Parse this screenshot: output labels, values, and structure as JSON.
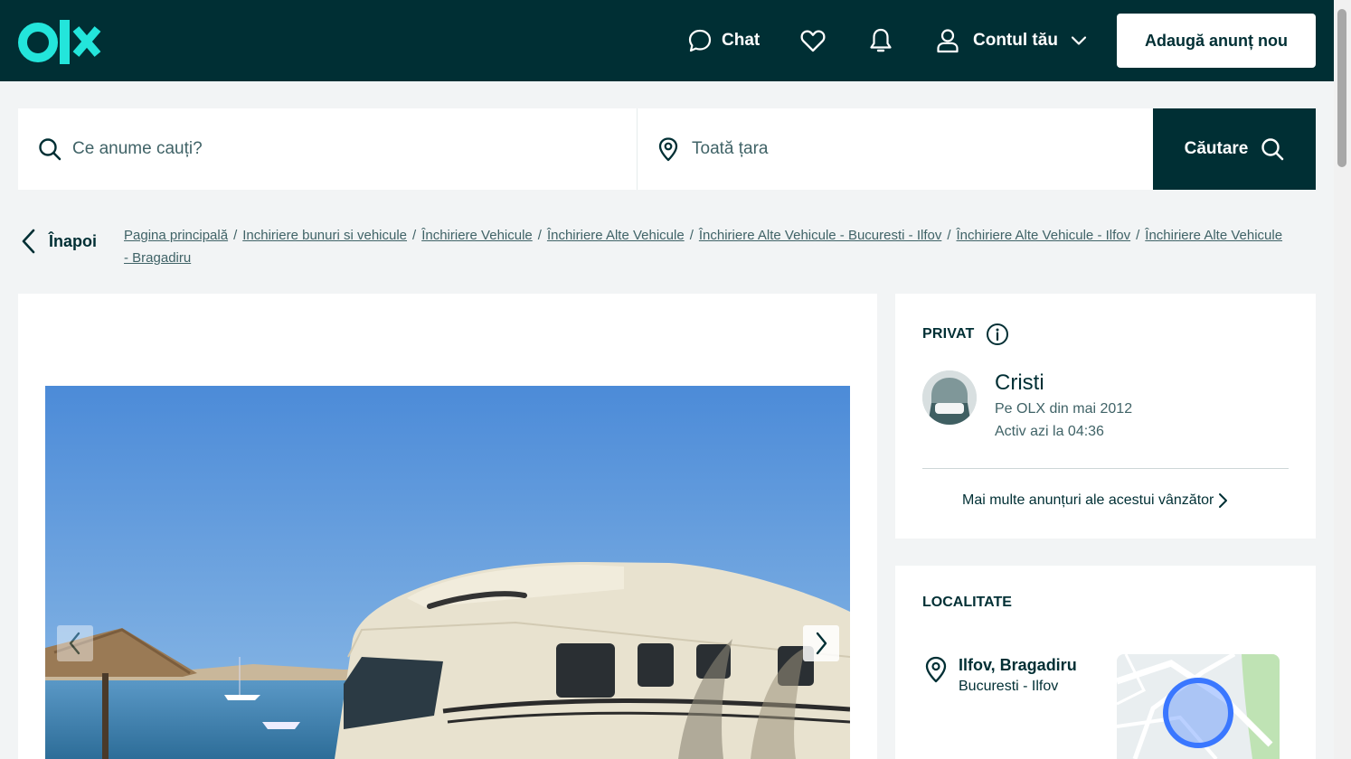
{
  "header": {
    "logo": "olx",
    "chat_label": "Chat",
    "account_label": "Contul tău",
    "post_button": "Adaugă anunț nou",
    "icons": [
      "chat-icon",
      "heart-icon",
      "bell-icon",
      "user-icon",
      "chevron-down-icon"
    ]
  },
  "search": {
    "query_placeholder": "Ce anume cauți?",
    "location_placeholder": "Toată țara",
    "button_label": "Căutare"
  },
  "breadcrumb": {
    "back_label": "Înapoi",
    "items": [
      "Pagina principală",
      "Inchiriere bunuri si vehicule",
      "Închiriere Vehicule",
      "Închiriere Alte Vehicule",
      "Închiriere Alte Vehicule - Bucuresti - Ilfov",
      "Închiriere Alte Vehicule - Ilfov",
      "Închiriere Alte Vehicule - Bragadiru"
    ]
  },
  "seller": {
    "type": "PRIVAT",
    "name": "Cristi",
    "since": "Pe OLX din mai 2012",
    "active": "Activ azi la 04:36",
    "more_ads": "Mai multe anunțuri ale acestui vânzător"
  },
  "location": {
    "title": "LOCALITATE",
    "city": "Ilfov, Bragadiru",
    "region": "Bucuresti - Ilfov"
  },
  "colors": {
    "brand_dark": "#002f34",
    "brand_teal": "#23e5db",
    "page_bg": "#f2f4f5"
  }
}
